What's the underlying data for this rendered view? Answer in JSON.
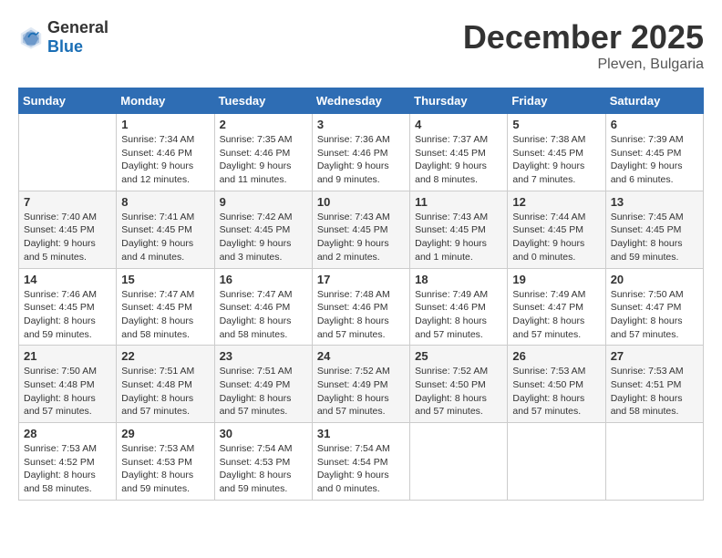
{
  "header": {
    "logo_general": "General",
    "logo_blue": "Blue",
    "month_title": "December 2025",
    "location": "Pleven, Bulgaria"
  },
  "weekdays": [
    "Sunday",
    "Monday",
    "Tuesday",
    "Wednesday",
    "Thursday",
    "Friday",
    "Saturday"
  ],
  "weeks": [
    [
      {
        "day": "",
        "info": ""
      },
      {
        "day": "1",
        "info": "Sunrise: 7:34 AM\nSunset: 4:46 PM\nDaylight: 9 hours\nand 12 minutes."
      },
      {
        "day": "2",
        "info": "Sunrise: 7:35 AM\nSunset: 4:46 PM\nDaylight: 9 hours\nand 11 minutes."
      },
      {
        "day": "3",
        "info": "Sunrise: 7:36 AM\nSunset: 4:46 PM\nDaylight: 9 hours\nand 9 minutes."
      },
      {
        "day": "4",
        "info": "Sunrise: 7:37 AM\nSunset: 4:45 PM\nDaylight: 9 hours\nand 8 minutes."
      },
      {
        "day": "5",
        "info": "Sunrise: 7:38 AM\nSunset: 4:45 PM\nDaylight: 9 hours\nand 7 minutes."
      },
      {
        "day": "6",
        "info": "Sunrise: 7:39 AM\nSunset: 4:45 PM\nDaylight: 9 hours\nand 6 minutes."
      }
    ],
    [
      {
        "day": "7",
        "info": "Sunrise: 7:40 AM\nSunset: 4:45 PM\nDaylight: 9 hours\nand 5 minutes."
      },
      {
        "day": "8",
        "info": "Sunrise: 7:41 AM\nSunset: 4:45 PM\nDaylight: 9 hours\nand 4 minutes."
      },
      {
        "day": "9",
        "info": "Sunrise: 7:42 AM\nSunset: 4:45 PM\nDaylight: 9 hours\nand 3 minutes."
      },
      {
        "day": "10",
        "info": "Sunrise: 7:43 AM\nSunset: 4:45 PM\nDaylight: 9 hours\nand 2 minutes."
      },
      {
        "day": "11",
        "info": "Sunrise: 7:43 AM\nSunset: 4:45 PM\nDaylight: 9 hours\nand 1 minute."
      },
      {
        "day": "12",
        "info": "Sunrise: 7:44 AM\nSunset: 4:45 PM\nDaylight: 9 hours\nand 0 minutes."
      },
      {
        "day": "13",
        "info": "Sunrise: 7:45 AM\nSunset: 4:45 PM\nDaylight: 8 hours\nand 59 minutes."
      }
    ],
    [
      {
        "day": "14",
        "info": "Sunrise: 7:46 AM\nSunset: 4:45 PM\nDaylight: 8 hours\nand 59 minutes."
      },
      {
        "day": "15",
        "info": "Sunrise: 7:47 AM\nSunset: 4:45 PM\nDaylight: 8 hours\nand 58 minutes."
      },
      {
        "day": "16",
        "info": "Sunrise: 7:47 AM\nSunset: 4:46 PM\nDaylight: 8 hours\nand 58 minutes."
      },
      {
        "day": "17",
        "info": "Sunrise: 7:48 AM\nSunset: 4:46 PM\nDaylight: 8 hours\nand 57 minutes."
      },
      {
        "day": "18",
        "info": "Sunrise: 7:49 AM\nSunset: 4:46 PM\nDaylight: 8 hours\nand 57 minutes."
      },
      {
        "day": "19",
        "info": "Sunrise: 7:49 AM\nSunset: 4:47 PM\nDaylight: 8 hours\nand 57 minutes."
      },
      {
        "day": "20",
        "info": "Sunrise: 7:50 AM\nSunset: 4:47 PM\nDaylight: 8 hours\nand 57 minutes."
      }
    ],
    [
      {
        "day": "21",
        "info": "Sunrise: 7:50 AM\nSunset: 4:48 PM\nDaylight: 8 hours\nand 57 minutes."
      },
      {
        "day": "22",
        "info": "Sunrise: 7:51 AM\nSunset: 4:48 PM\nDaylight: 8 hours\nand 57 minutes."
      },
      {
        "day": "23",
        "info": "Sunrise: 7:51 AM\nSunset: 4:49 PM\nDaylight: 8 hours\nand 57 minutes."
      },
      {
        "day": "24",
        "info": "Sunrise: 7:52 AM\nSunset: 4:49 PM\nDaylight: 8 hours\nand 57 minutes."
      },
      {
        "day": "25",
        "info": "Sunrise: 7:52 AM\nSunset: 4:50 PM\nDaylight: 8 hours\nand 57 minutes."
      },
      {
        "day": "26",
        "info": "Sunrise: 7:53 AM\nSunset: 4:50 PM\nDaylight: 8 hours\nand 57 minutes."
      },
      {
        "day": "27",
        "info": "Sunrise: 7:53 AM\nSunset: 4:51 PM\nDaylight: 8 hours\nand 58 minutes."
      }
    ],
    [
      {
        "day": "28",
        "info": "Sunrise: 7:53 AM\nSunset: 4:52 PM\nDaylight: 8 hours\nand 58 minutes."
      },
      {
        "day": "29",
        "info": "Sunrise: 7:53 AM\nSunset: 4:53 PM\nDaylight: 8 hours\nand 59 minutes."
      },
      {
        "day": "30",
        "info": "Sunrise: 7:54 AM\nSunset: 4:53 PM\nDaylight: 8 hours\nand 59 minutes."
      },
      {
        "day": "31",
        "info": "Sunrise: 7:54 AM\nSunset: 4:54 PM\nDaylight: 9 hours\nand 0 minutes."
      },
      {
        "day": "",
        "info": ""
      },
      {
        "day": "",
        "info": ""
      },
      {
        "day": "",
        "info": ""
      }
    ]
  ]
}
